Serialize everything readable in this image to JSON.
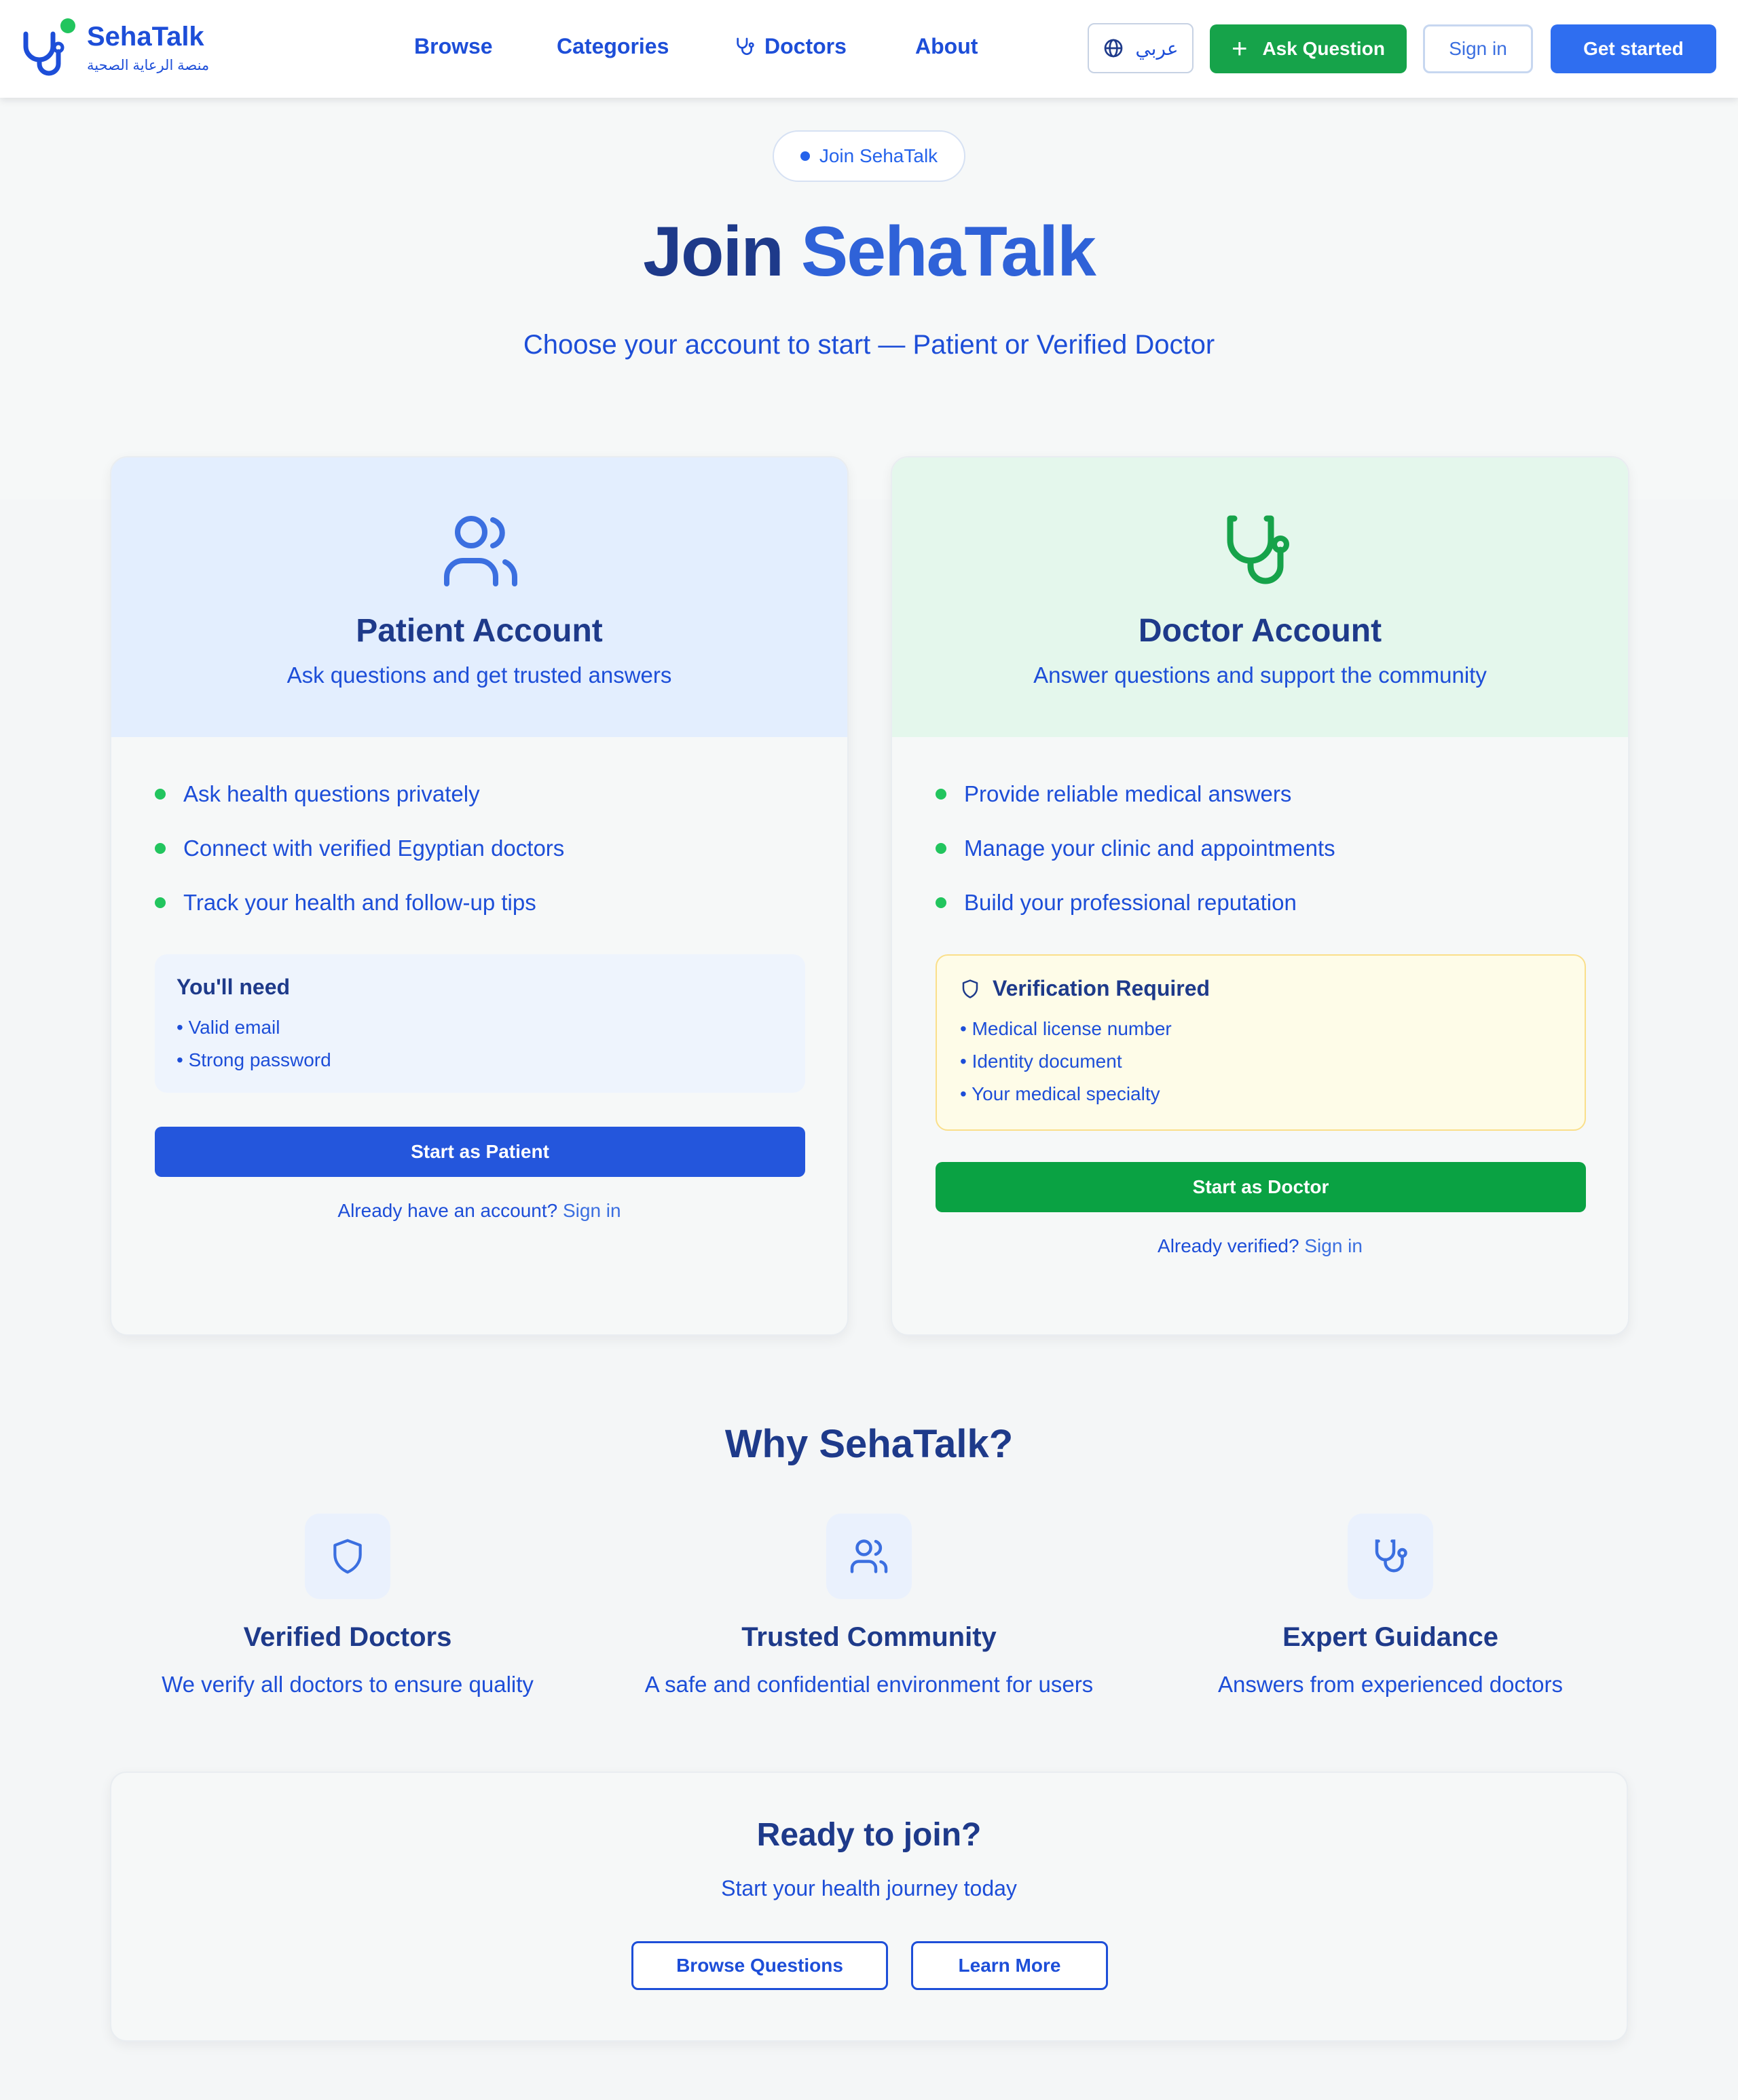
{
  "header": {
    "brand_name": "SehaTalk",
    "brand_subtitle": "منصة الرعاية الصحية",
    "nav": [
      {
        "label": "Browse"
      },
      {
        "label": "Categories"
      },
      {
        "label": "Doctors",
        "icon": "stethoscope-icon"
      },
      {
        "label": "About"
      }
    ],
    "language_label": "عربي",
    "ask_label": "Ask Question",
    "signin_label": "Sign in",
    "get_started_label": "Get started"
  },
  "hero": {
    "badge": "Join SehaTalk",
    "title_part1": "Join",
    "title_part2": "SehaTalk",
    "subtitle": "Choose your account to start — Patient or Verified Doctor"
  },
  "patient_card": {
    "icon": "users-icon",
    "title": "Patient Account",
    "description": "Ask questions and get trusted answers",
    "features": [
      "Ask health questions privately",
      "Connect with verified Egyptian doctors",
      "Track your health and follow-up tips"
    ],
    "need_title": "You'll need",
    "need_items": [
      "• Valid email",
      "• Strong password"
    ],
    "button": "Start as Patient",
    "footer_text": "Already have an account?",
    "footer_link": "Sign in"
  },
  "doctor_card": {
    "icon": "stethoscope-icon",
    "title": "Doctor Account",
    "description": "Answer questions and support the community",
    "features": [
      "Provide reliable medical answers",
      "Manage your clinic and appointments",
      "Build your professional reputation"
    ],
    "verify_title": "Verification Required",
    "verify_items": [
      "• Medical license number",
      "• Identity document",
      "• Your medical specialty"
    ],
    "button": "Start as Doctor",
    "footer_text": "Already verified?",
    "footer_link": "Sign in"
  },
  "why": {
    "title": "Why SehaTalk?",
    "features": [
      {
        "icon": "shield-icon",
        "title": "Verified Doctors",
        "description": "We verify all doctors to ensure quality"
      },
      {
        "icon": "users-icon",
        "title": "Trusted Community",
        "description": "A safe and confidential environment for users"
      },
      {
        "icon": "stethoscope-icon",
        "title": "Expert Guidance",
        "description": "Answers from experienced doctors"
      }
    ]
  },
  "ready": {
    "title": "Ready to join?",
    "subtitle": "Start your health journey today",
    "browse_button": "Browse Questions",
    "learn_button": "Learn More"
  },
  "colors": {
    "primary": "#1d4ed8",
    "navy": "#1e3a8a",
    "green": "#16a34a",
    "patient_bg": "#e3eefe",
    "doctor_bg": "#e4f7ec",
    "verify_bg": "#fefce8"
  }
}
